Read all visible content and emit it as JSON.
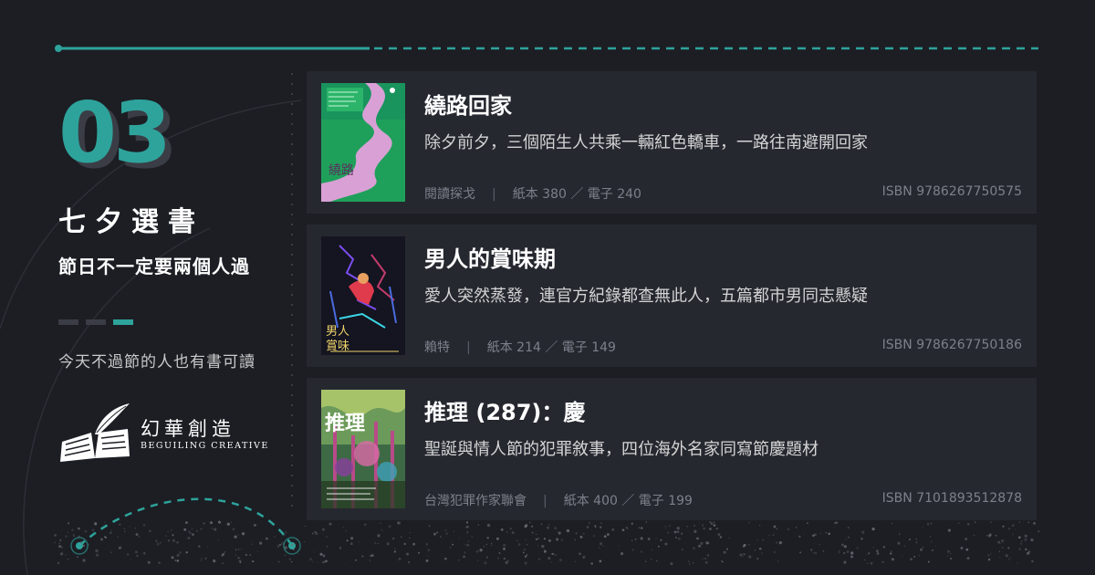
{
  "header": {
    "number": "03",
    "title": "七夕選書",
    "subtitle": "節日不一定要兩個人過",
    "tagline": "今天不過節的人也有書可讀"
  },
  "brand": {
    "name": "幻華創造",
    "name_en": "BEGUILING CREATIVE"
  },
  "colors": {
    "accent": "#2ea39b",
    "background": "#1c1e24",
    "card": "#262830"
  },
  "books": [
    {
      "title": "繞路回家",
      "description": "除夕前夕，三個陌生人共乘一輛紅色轎車，一路往南避開回家",
      "author": "閱讀探戈",
      "formats": "紙本 380 ／ 電子 240",
      "isbn": "ISBN 9786267750575",
      "cover_icon": "green-road-cover-icon"
    },
    {
      "title": "男人的賞味期",
      "description": "愛人突然蒸發，連官方紀錄都查無此人，五篇都市男同志懸疑",
      "author": "賴特",
      "formats": "紙本 214 ／ 電子 149",
      "isbn": "ISBN 9786267750186",
      "cover_icon": "neon-figure-cover-icon"
    },
    {
      "title": "推理 (287)：慶",
      "description": "聖誕與情人節的犯罪敘事，四位海外名家同寫節慶題材",
      "author": "台灣犯罪作家聯會",
      "formats": "紙本 400 ／ 電子 199",
      "isbn": "ISBN 7101893512878",
      "cover_icon": "forest-mystery-cover-icon"
    }
  ]
}
